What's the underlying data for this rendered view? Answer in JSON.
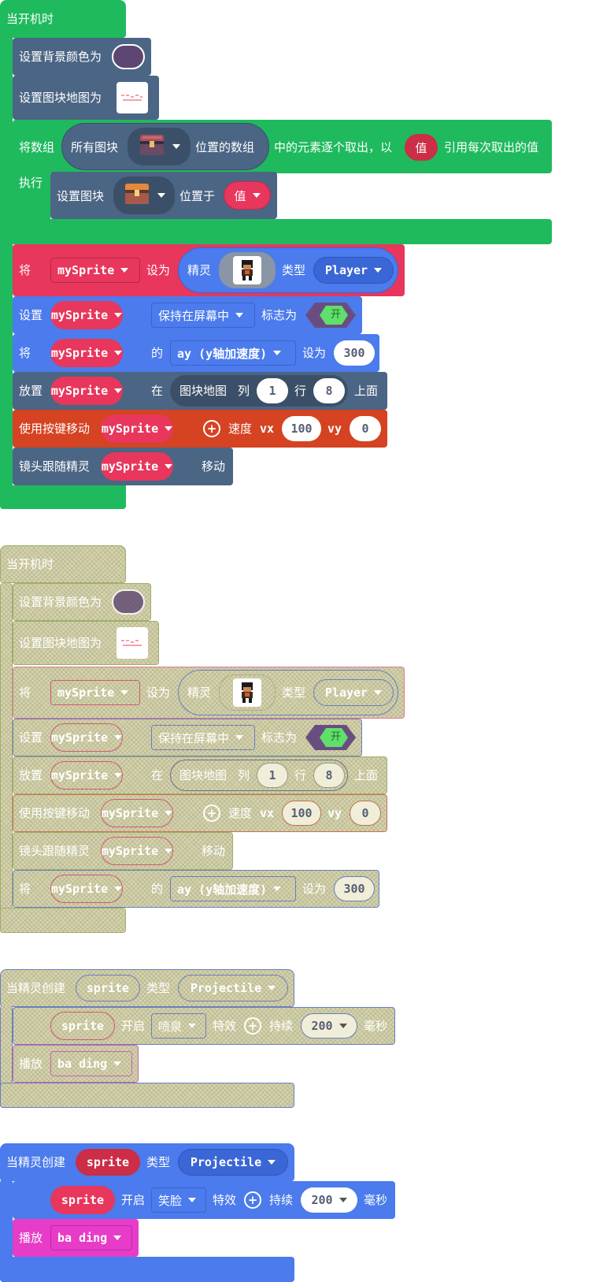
{
  "stack1": {
    "hat": "当开机时",
    "set_bg": "设置背景颜色为",
    "bg_color": "#5e4672",
    "set_tilemap": "设置图块地图为",
    "for_array": "将数组",
    "all_tiles": "所有图块",
    "positions_array": "位置的数组",
    "each_element": "中的元素逐个取出，以",
    "value_var": "值",
    "ref_each": "引用每次取出的值",
    "execute": "执行",
    "set_tile": "设置图块",
    "located_at": "位置于",
    "value_var2": "值",
    "set_var": "将",
    "sprite_var": "mySprite",
    "set_to": "设为",
    "sprite": "精灵",
    "kind": "类型",
    "kind_player": "Player",
    "set": "设置",
    "stay_in_screen": "保持在屏幕中",
    "flag_is": "标志为",
    "toggle_on": "开",
    "of": "的",
    "ay_prop": "ay (y轴加速度)",
    "set_to2": "设为",
    "ay_value": "300",
    "place": "放置",
    "on": "在",
    "tilemap": "图块地图",
    "col": "列",
    "col_value": "1",
    "row": "行",
    "row_value": "8",
    "above": "上面",
    "move_with_buttons": "使用按键移动",
    "speed": "速度",
    "vx": "vx",
    "vx_value": "100",
    "vy": "vy",
    "vy_value": "0",
    "camera_follow": "镜头跟随精灵",
    "move": "移动"
  },
  "stack2": {
    "hat": "当开机时",
    "set_bg": "设置背景颜色为",
    "set_tilemap": "设置图块地图为",
    "set_var": "将",
    "sprite_var": "mySprite",
    "set_to": "设为",
    "sprite": "精灵",
    "kind": "类型",
    "kind_player": "Player",
    "set": "设置",
    "stay_in_screen": "保持在屏幕中",
    "flag_is": "标志为",
    "toggle_on": "开",
    "place": "放置",
    "on": "在",
    "tilemap": "图块地图",
    "col": "列",
    "col_value": "1",
    "row": "行",
    "row_value": "8",
    "above": "上面",
    "move_with_buttons": "使用按键移动",
    "speed": "速度",
    "vx": "vx",
    "vx_value": "100",
    "vy": "vy",
    "vy_value": "0",
    "camera_follow": "镜头跟随精灵",
    "move": "移动",
    "of": "的",
    "ay_prop": "ay (y轴加速度)",
    "set_to2": "设为",
    "ay_value": "300"
  },
  "stack3": {
    "hat": "当精灵创建",
    "sprite_param": "sprite",
    "kind": "类型",
    "kind_value": "Projectile",
    "sprite_ref": "sprite",
    "start": "开启",
    "effect": "喷泉",
    "effect_label": "特效",
    "duration": "持续",
    "duration_value": "200",
    "ms": "毫秒",
    "play": "播放",
    "sound": "ba ding"
  },
  "stack4": {
    "hat": "当精灵创建",
    "sprite_param": "sprite",
    "kind": "类型",
    "kind_value": "Projectile",
    "sprite_ref": "sprite",
    "start": "开启",
    "effect": "笑脸",
    "effect_label": "特效",
    "duration": "持续",
    "duration_value": "200",
    "ms": "毫秒",
    "play": "播放",
    "sound": "ba ding"
  },
  "colors": {
    "loops_green": "#1fba5e",
    "scene_slate": "#4b6584",
    "sprite_red": "#e8365d",
    "sprite_blue": "#4b7bec",
    "controller_orange": "#d54322",
    "music_magenta": "#e63cc8",
    "disabled_khaki": "#d8d3a0"
  }
}
